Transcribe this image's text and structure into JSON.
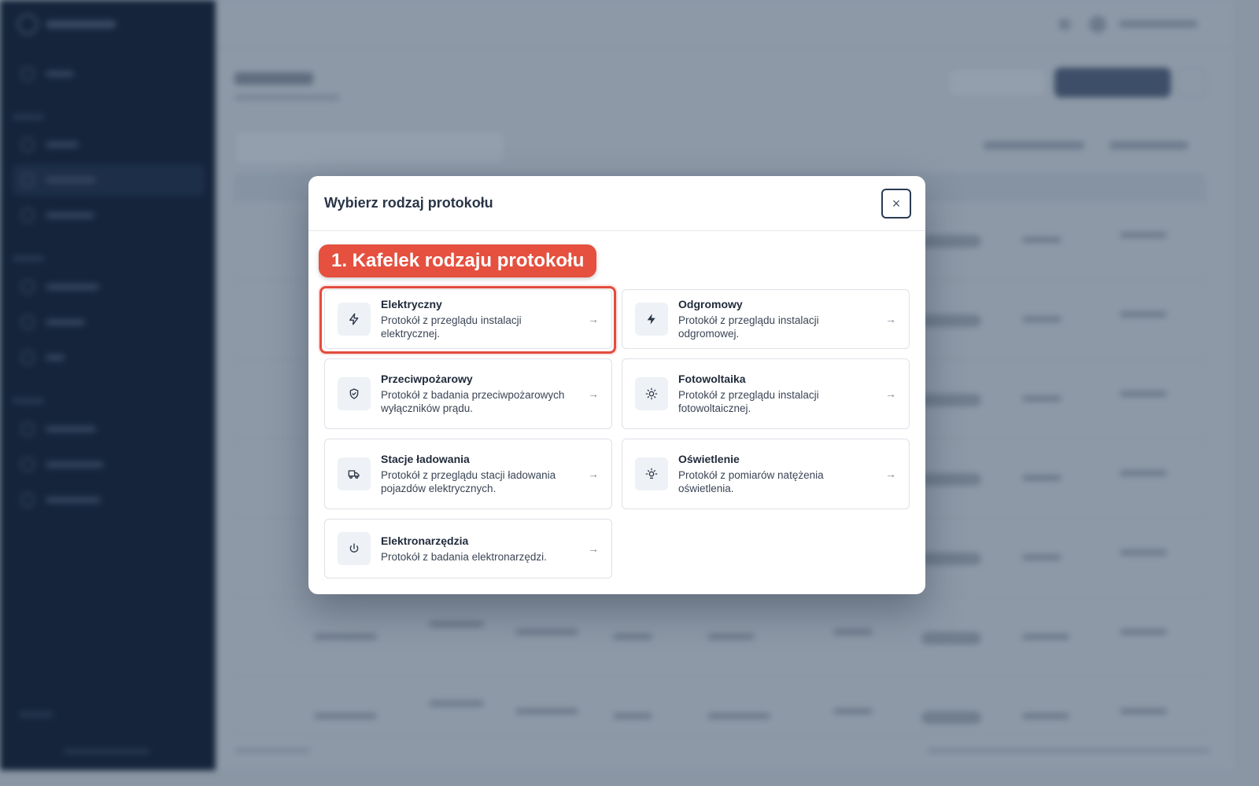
{
  "modal": {
    "title": "Wybierz rodzaj protokołu",
    "close_icon": "×"
  },
  "annotation": {
    "label": "1. Kafelek rodzaju protokołu",
    "color": "#e5503f"
  },
  "tiles": [
    {
      "icon": "bolt-outline-icon",
      "title": "Elektryczny",
      "desc": "Protokół z przeglądu instalacji elektrycznej."
    },
    {
      "icon": "bolt-filled-icon",
      "title": "Odgromowy",
      "desc": "Protokół z przeglądu instalacji odgromowej."
    },
    {
      "icon": "shield-check-icon",
      "title": "Przeciwpożarowy",
      "desc": "Protokół z badania przeciwpożarowych wyłączników prądu."
    },
    {
      "icon": "sun-icon",
      "title": "Fotowoltaika",
      "desc": "Protokół z przeglądu instalacji fotowoltaicznej."
    },
    {
      "icon": "truck-icon",
      "title": "Stacje ładowania",
      "desc": "Protokół z przeglądu stacji ładowania pojazdów elektrycznych."
    },
    {
      "icon": "lightbulb-icon",
      "title": "Oświetlenie",
      "desc": "Protokół z pomiarów natężenia oświetlenia."
    },
    {
      "icon": "power-icon",
      "title": "Elektronarzędzia",
      "desc": "Protokół z badania elektronarzędzi."
    }
  ],
  "tile_arrow": "→"
}
